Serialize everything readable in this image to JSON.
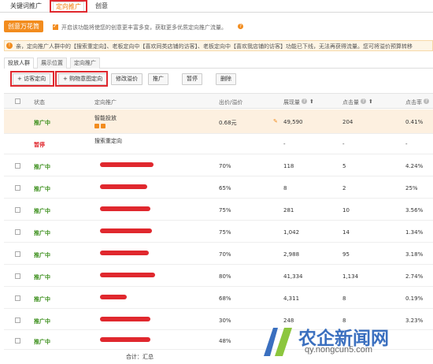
{
  "tabs": [
    "关键词推广",
    "定向推广",
    "创意"
  ],
  "toolbar": {
    "creative_button": "创意万花筒",
    "enable_text": "开启该功能将使您的创意更丰富多变，获取更多优质定向推广流量。",
    "notice": "亲，定向推广人群中的【搜索重定向】、老板定向中【喜欢同类店铺的访客】、老板定向中【喜欢我店铺的访客】功能已下线，无法再获得流量。您可将溢价预算转移"
  },
  "sub_tabs": [
    "投放人群",
    "展示位置",
    "定向推广"
  ],
  "actions": [
    "+ 访客定向",
    "+ 购物意图定向",
    "修改溢价",
    "推广",
    "暂停",
    "删除"
  ],
  "table": {
    "headers": [
      "状态",
      "定向推广",
      "出价/溢价",
      "展现量",
      "点击量",
      "点击率"
    ],
    "rows": [
      {
        "status": "推广中",
        "name": "智能投放",
        "bid": "0.68元",
        "impressions": "49,590",
        "clicks": "204",
        "ctr": "0.41%"
      },
      {
        "status": "暂停",
        "name": "搜索重定向",
        "bid": "",
        "impressions": "-",
        "clicks": "-",
        "ctr": "-"
      },
      {
        "status": "推广中",
        "name": "",
        "bid": "70%",
        "impressions": "118",
        "clicks": "5",
        "ctr": "4.24%"
      },
      {
        "status": "推广中",
        "name": "",
        "bid": "65%",
        "impressions": "8",
        "clicks": "2",
        "ctr": "25%"
      },
      {
        "status": "推广中",
        "name": "",
        "bid": "75%",
        "impressions": "281",
        "clicks": "10",
        "ctr": "3.56%"
      },
      {
        "status": "推广中",
        "name": "",
        "bid": "75%",
        "impressions": "1,042",
        "clicks": "14",
        "ctr": "1.34%"
      },
      {
        "status": "推广中",
        "name": "",
        "bid": "70%",
        "impressions": "2,988",
        "clicks": "95",
        "ctr": "3.18%"
      },
      {
        "status": "推广中",
        "name": "",
        "bid": "80%",
        "impressions": "41,334",
        "clicks": "1,134",
        "ctr": "2.74%"
      },
      {
        "status": "推广中",
        "name": "",
        "bid": "68%",
        "impressions": "4,311",
        "clicks": "8",
        "ctr": "0.19%"
      },
      {
        "status": "推广中",
        "name": "",
        "bid": "30%",
        "impressions": "248",
        "clicks": "8",
        "ctr": "3.23%"
      },
      {
        "status": "推广中",
        "name": "",
        "bid": "48%",
        "impressions": "",
        "clicks": "",
        "ctr": ""
      }
    ],
    "total_label": "合计：汇总"
  },
  "watermark": {
    "text": "农企新闻网",
    "url": "qy.nongcun5.com"
  }
}
